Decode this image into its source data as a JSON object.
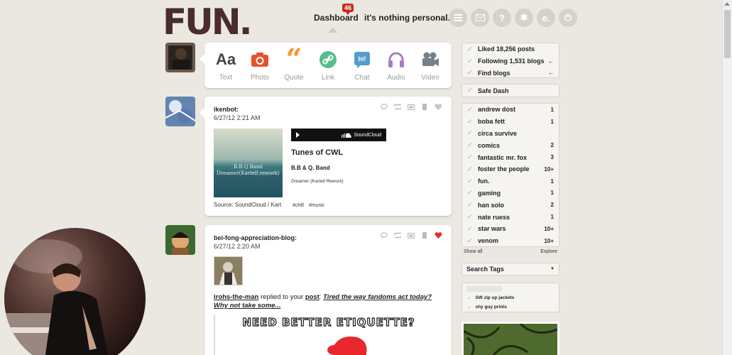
{
  "header": {
    "logo": "FUN.",
    "nav_dashboard": "Dashboard",
    "notification_count": "46",
    "blog_name": "it's nothing personal...",
    "icons": [
      "list-icon",
      "mail-icon",
      "help-icon",
      "settings-icon",
      "edit-icon",
      "power-icon"
    ]
  },
  "composer": {
    "types": [
      {
        "label": "Text",
        "icon": "text-icon",
        "color": "#444444"
      },
      {
        "label": "Photo",
        "icon": "camera-icon",
        "color": "#e6522c"
      },
      {
        "label": "Quote",
        "icon": "quote-icon",
        "color": "#f2992e"
      },
      {
        "label": "Link",
        "icon": "link-icon",
        "color": "#56bc8a"
      },
      {
        "label": "Chat",
        "icon": "chat-icon",
        "color": "#529ecc"
      },
      {
        "label": "Audio",
        "icon": "headphones-icon",
        "color": "#a77dc2"
      },
      {
        "label": "Video",
        "icon": "video-camera-icon",
        "color": "#748089"
      }
    ]
  },
  "posts": [
    {
      "user": "ikenbot:",
      "time": "6/27/12 2:21 AM",
      "audio_provider": "SoundCloud",
      "cover_line1": "B.B.Q Band",
      "cover_line2": "Dreamer(Kartell rework)",
      "title": "Tunes of CWL",
      "artist": "B.B & Q. Band",
      "track": "Dreamer (Kartell Rework)",
      "source": "Source: SoundCloud / Kart",
      "tags": [
        "#chill",
        "#music"
      ]
    },
    {
      "user": "bei-fong-appreciation-blog:",
      "time": "6/27/12 2:20 AM",
      "reply_user": "irohs-the-man",
      "reply_text": "replied to your",
      "reply_link": "post",
      "quote": "Tired the way fandoms act today? Why not take some...",
      "image_caption": "NEED BETTER ETIQUETTE?",
      "liked": true
    }
  ],
  "sidebar": {
    "account": [
      {
        "label": "Liked 18,256 posts",
        "arrow": ""
      },
      {
        "label": "Following 1,531 blogs",
        "arrow": "←"
      },
      {
        "label": "Find blogs",
        "arrow": "←"
      }
    ],
    "safe_dash": "Safe Dash",
    "tags": [
      {
        "name": "andrew dost",
        "count": "1"
      },
      {
        "name": "boba fett",
        "count": "1"
      },
      {
        "name": "circa survive",
        "count": ""
      },
      {
        "name": "comics",
        "count": "2"
      },
      {
        "name": "fantastic mr. fox",
        "count": "3"
      },
      {
        "name": "foster the people",
        "count": "10+"
      },
      {
        "name": "fun.",
        "count": "1"
      },
      {
        "name": "gaming",
        "count": "1"
      },
      {
        "name": "han solo",
        "count": "2"
      },
      {
        "name": "nate ruess",
        "count": "1"
      },
      {
        "name": "star wars",
        "count": "10+"
      },
      {
        "name": "venom",
        "count": "10+"
      }
    ],
    "show_all": "Show all",
    "explore": "Explore",
    "search_tags": "Search Tags",
    "radar": [
      "SW zip up jackets",
      "shy guy prints"
    ]
  }
}
